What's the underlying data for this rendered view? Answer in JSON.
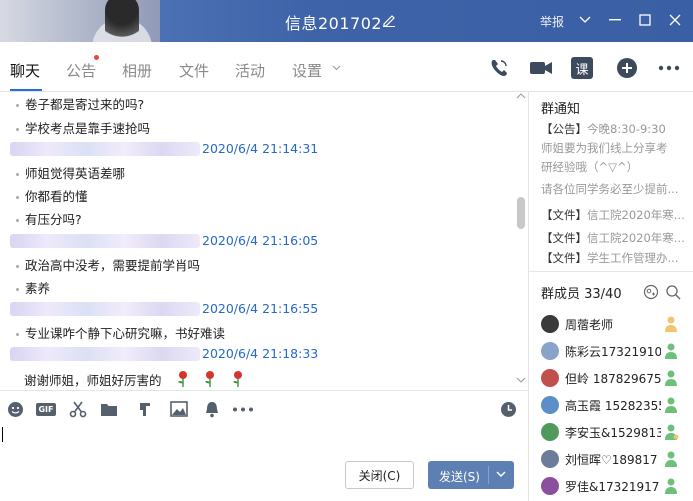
{
  "window": {
    "title": "信息201702",
    "report_label": "举报",
    "colors": {
      "accent": "#1f6fde",
      "titlebar": "#3e63a8",
      "time": "#2769c9",
      "send": "#5e7fb3"
    }
  },
  "tabs": [
    {
      "label": "聊天"
    },
    {
      "label": "公告"
    },
    {
      "label": "相册"
    },
    {
      "label": "文件"
    },
    {
      "label": "活动"
    },
    {
      "label": "设置"
    }
  ],
  "tab_tools": [
    "phone-icon",
    "video-icon",
    "course-icon",
    "add-icon",
    "more-icon"
  ],
  "course_icon_label": "课",
  "messages": [
    {
      "kind": "text",
      "text": "卷子都是寄过来的吗?"
    },
    {
      "kind": "text",
      "text": "学校考点是靠手速抢吗"
    },
    {
      "kind": "stamp",
      "time": "2020/6/4 21:14:31"
    },
    {
      "kind": "text",
      "text": "师姐觉得英语差哪"
    },
    {
      "kind": "text",
      "text": "你都看的懂"
    },
    {
      "kind": "text",
      "text": "有压分吗?"
    },
    {
      "kind": "stamp",
      "time": "2020/6/4 21:16:05"
    },
    {
      "kind": "text",
      "text": "政治高中没考，需要提前学肖吗"
    },
    {
      "kind": "text",
      "text": "素养"
    },
    {
      "kind": "stamp",
      "time": "2020/6/4 21:16:55"
    },
    {
      "kind": "text",
      "text": "专业课咋个静下心研究嘛，书好难读"
    },
    {
      "kind": "stamp",
      "time": "2020/6/4 21:18:33"
    },
    {
      "kind": "text",
      "text": "谢谢师姐，师姐好厉害的"
    }
  ],
  "input_toolbar": [
    "emoji-icon",
    "gif-icon",
    "scissors-icon",
    "folder-icon",
    "music-icon",
    "image-icon",
    "bell-icon",
    "more-dots-icon",
    "history-icon"
  ],
  "gif_label": "GIF",
  "buttons": {
    "close": "关闭(C)",
    "send": "发送(S)"
  },
  "announcements": {
    "title": "群通知",
    "items": [
      {
        "tag": "【公告】",
        "text": "今晚8:30-9:30"
      },
      {
        "tag": "",
        "text": "师姐要为我们线上分享考"
      },
      {
        "tag": "",
        "text": "研经验哦（^▽^）"
      },
      {
        "tag": "",
        "text": "请各位同学务必至少提前..."
      },
      {
        "tag": "【文件】",
        "text": "信工院2020年寒..."
      },
      {
        "tag": "【文件】",
        "text": "信工院2020年寒..."
      },
      {
        "tag": "【文件】",
        "text": "学生工作管理办..."
      }
    ]
  },
  "members": {
    "title": "群成员 33/40",
    "list": [
      {
        "name": "周蓿老师",
        "avatar_color": "#3a3a3a"
      },
      {
        "name": "陈彩云17321910",
        "avatar_color": "#8aa3c9"
      },
      {
        "name": "但岭 187829675",
        "avatar_color": "#c0504d"
      },
      {
        "name": "高玉霞 15282355",
        "avatar_color": "#5c8fc7"
      },
      {
        "name": "李安玉&1529813",
        "avatar_color": "#4f9a5b"
      },
      {
        "name": "刘恒晖♡189817",
        "avatar_color": "#6b7d99"
      },
      {
        "name": "罗佳&17321917",
        "avatar_color": "#8a4f9e"
      }
    ]
  }
}
